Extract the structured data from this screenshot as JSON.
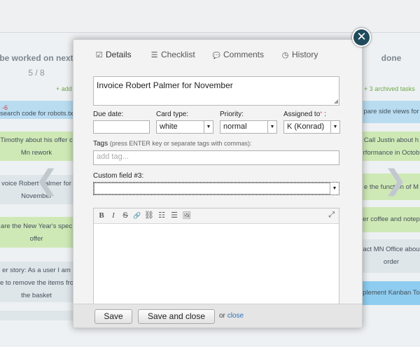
{
  "board": {
    "left_column": {
      "title": "be worked on next",
      "count": "5 / 8",
      "add_link": "+ add",
      "cards": [
        "search code for robots.txt",
        "Timothy about his offer c",
        "Mn rework",
        "voice Robert Palmer for",
        "November",
        "are the New Year's spec",
        "offer",
        "er story: As a user I am",
        "e to remove the items fro",
        "the basket"
      ],
      "tag_mark": "-6"
    },
    "right_column": {
      "title": "done",
      "archived_link": "+ 3 archived tasks",
      "cards": [
        "pare side views for",
        "Call Justin about h",
        "rformance in Octob",
        "e the function of M",
        "er coffee and notep",
        "act MN Office abou",
        "order",
        "plement Kanban To"
      ]
    },
    "nav_left": "❮",
    "nav_right": "❯"
  },
  "modal": {
    "close_symbol": "✕",
    "tabs": [
      {
        "label": "Details",
        "icon": "☑"
      },
      {
        "label": "Checklist",
        "icon": "☰"
      },
      {
        "label": "Comments",
        "icon": "💬"
      },
      {
        "label": "History",
        "icon": "◷"
      }
    ],
    "title_value": "Invoice Robert Palmer for November",
    "due_date": {
      "label": "Due date:",
      "value": ""
    },
    "card_type": {
      "label": "Card type:",
      "value": "white"
    },
    "priority": {
      "label": "Priority:",
      "value": "normal"
    },
    "assigned_to": {
      "label": "Assigned to",
      "req": "*",
      "suffix": ":",
      "value": "K (Konrad)"
    },
    "tags": {
      "label": "Tags",
      "hint": "(press ENTER key or separate tags with commas):",
      "placeholder": "add tag..."
    },
    "custom_field": {
      "label": "Custom field #3:",
      "value": ""
    },
    "editor_tools": [
      "B",
      "I",
      "S",
      "🔗",
      "⛓",
      "☷",
      "☰",
      "🖼"
    ],
    "footer": {
      "save": "Save",
      "save_close": "Save and close",
      "or": "or",
      "close": "close"
    }
  }
}
